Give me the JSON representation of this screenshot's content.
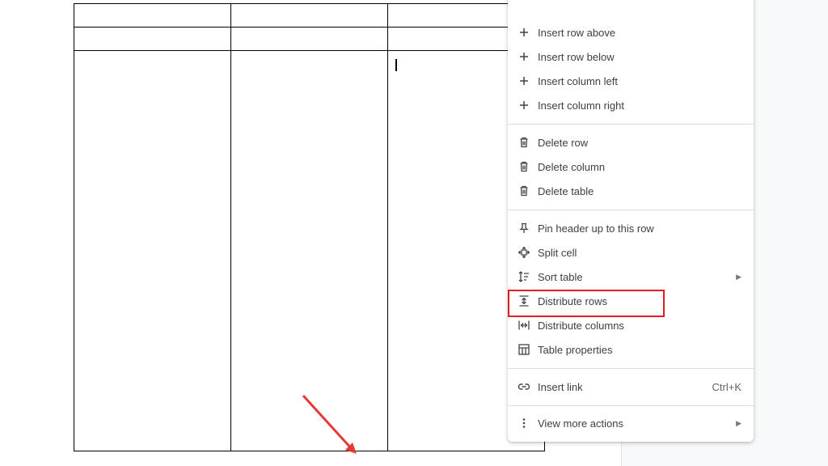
{
  "context_menu": {
    "insert_row_above": "Insert row above",
    "insert_row_below": "Insert row below",
    "insert_column_left": "Insert column left",
    "insert_column_right": "Insert column right",
    "delete_row": "Delete row",
    "delete_column": "Delete column",
    "delete_table": "Delete table",
    "pin_header": "Pin header up to this row",
    "split_cell": "Split cell",
    "sort_table": "Sort table",
    "distribute_rows": "Distribute rows",
    "distribute_columns": "Distribute columns",
    "table_properties": "Table properties",
    "insert_link": "Insert link",
    "insert_link_shortcut": "Ctrl+K",
    "view_more_actions": "View more actions"
  },
  "colors": {
    "highlight_box": "#e01e1e",
    "annotation_arrow": "#e53935"
  },
  "icons": {
    "insert": "plus-icon",
    "delete": "trash-icon",
    "pin": "pin-icon",
    "split": "split-cell-icon",
    "sort": "sort-icon",
    "distribute_rows": "distribute-rows-icon",
    "distribute_columns": "distribute-columns-icon",
    "table_properties": "table-icon",
    "link": "link-icon",
    "more": "more-vert-icon",
    "submenu": "submenu-arrow-icon"
  }
}
